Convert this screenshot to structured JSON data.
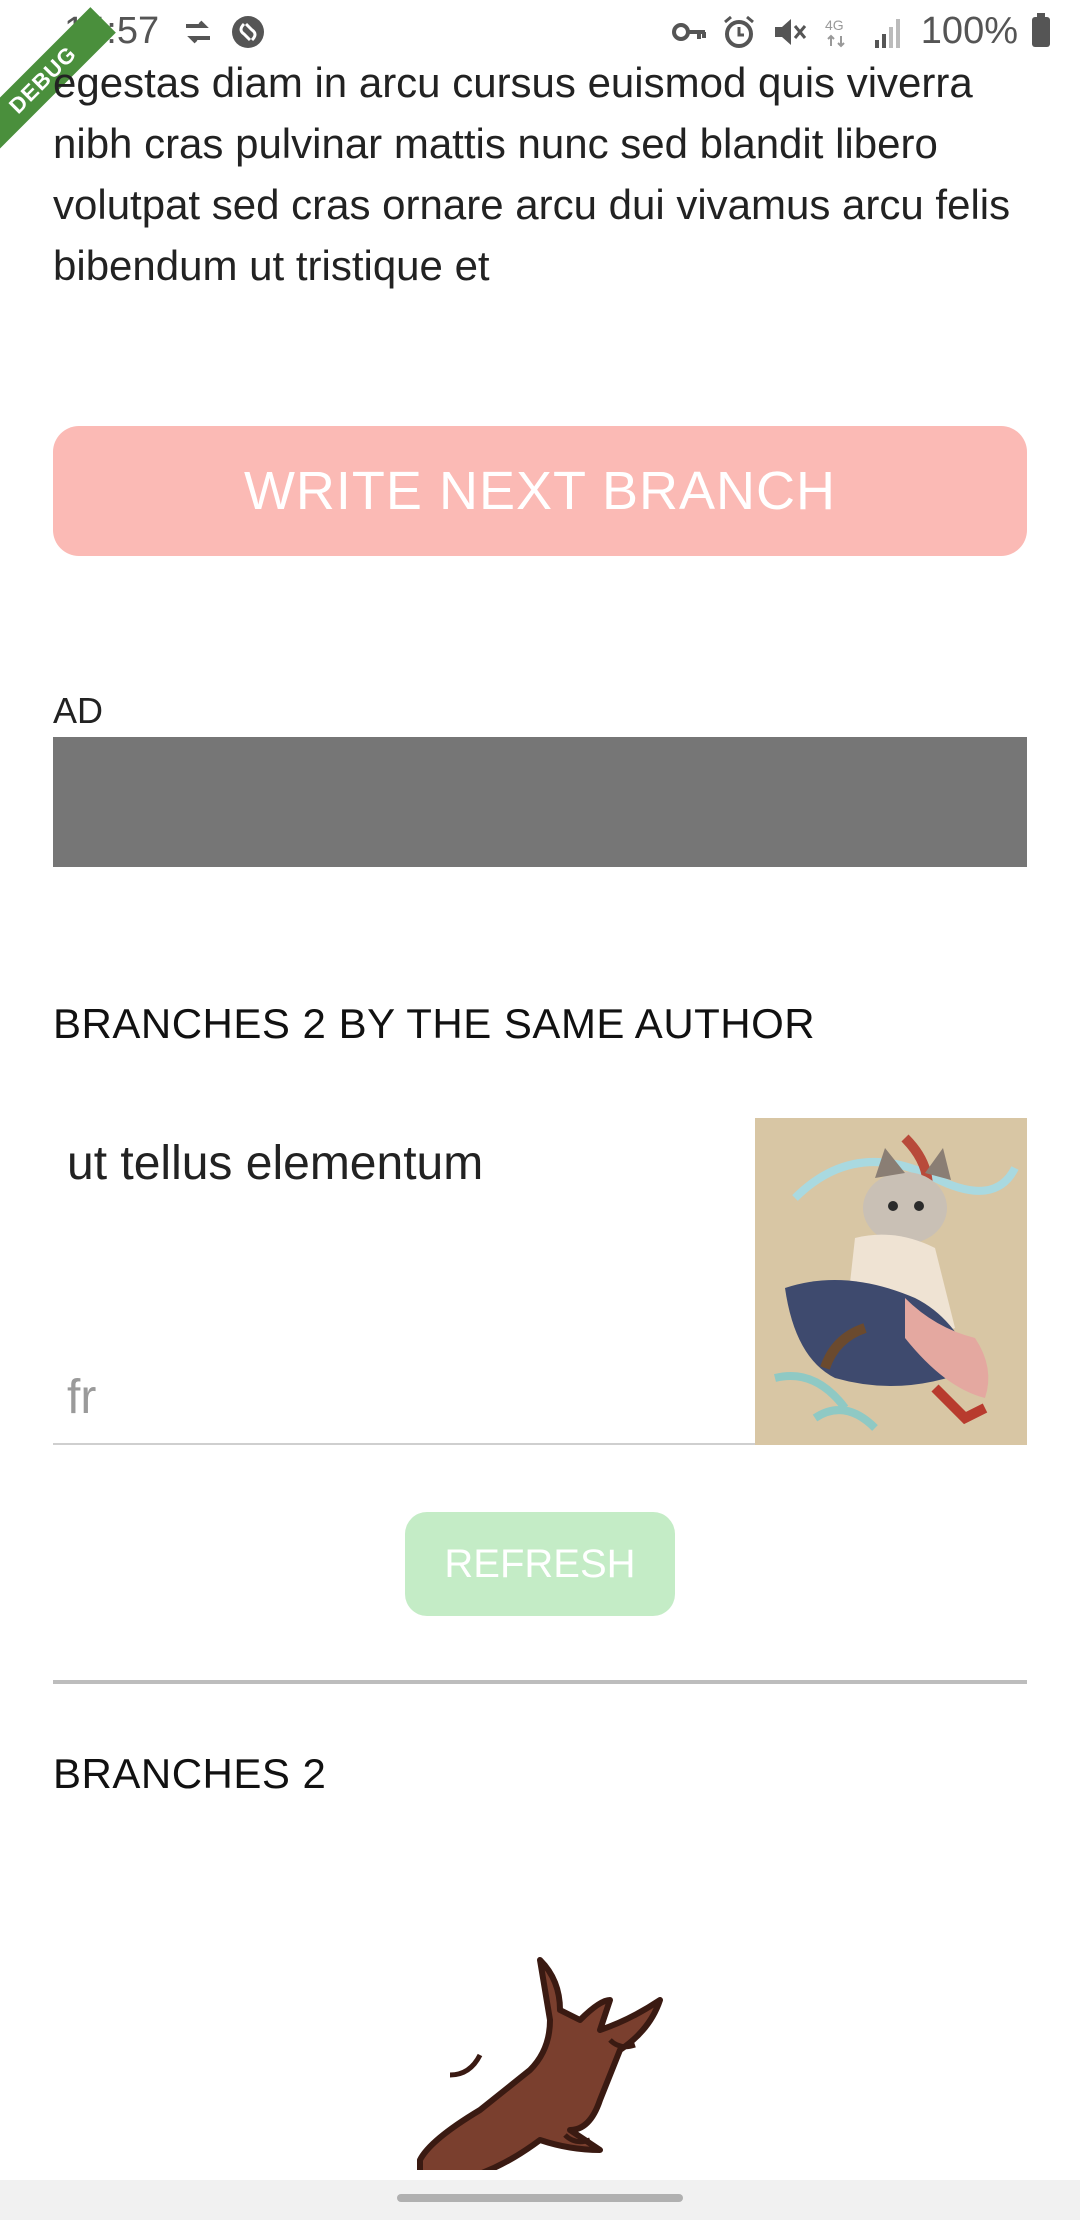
{
  "status_bar": {
    "time": "14:57",
    "battery": "100%",
    "network": "4G",
    "left_icons": [
      "sync-icon",
      "shazam-icon"
    ],
    "right_icons": [
      "vpn-key-icon",
      "alarm-icon",
      "mute-icon",
      "network-4g-icon",
      "signal-icon",
      "battery-icon"
    ]
  },
  "debug_banner": "DEBUG",
  "story": {
    "text": "egestas diam in arcu cursus euismod quis viverra nibh cras pulvinar mattis nunc sed blandit libero volutpat sed cras ornare arcu dui vivamus arcu felis bibendum ut tristique et"
  },
  "write_button": {
    "label": "WRITE NEXT BRANCH",
    "color": "#fbbab5"
  },
  "ad": {
    "label": "AD",
    "color": "#767676"
  },
  "same_author": {
    "title": "BRANCHES 2 BY THE SAME AUTHOR",
    "card": {
      "title": "ut tellus elementum",
      "lang": "fr"
    }
  },
  "refresh_button": {
    "label": "REFRESH",
    "color": "#c4ecc6"
  },
  "branches": {
    "title": "BRANCHES 2"
  }
}
